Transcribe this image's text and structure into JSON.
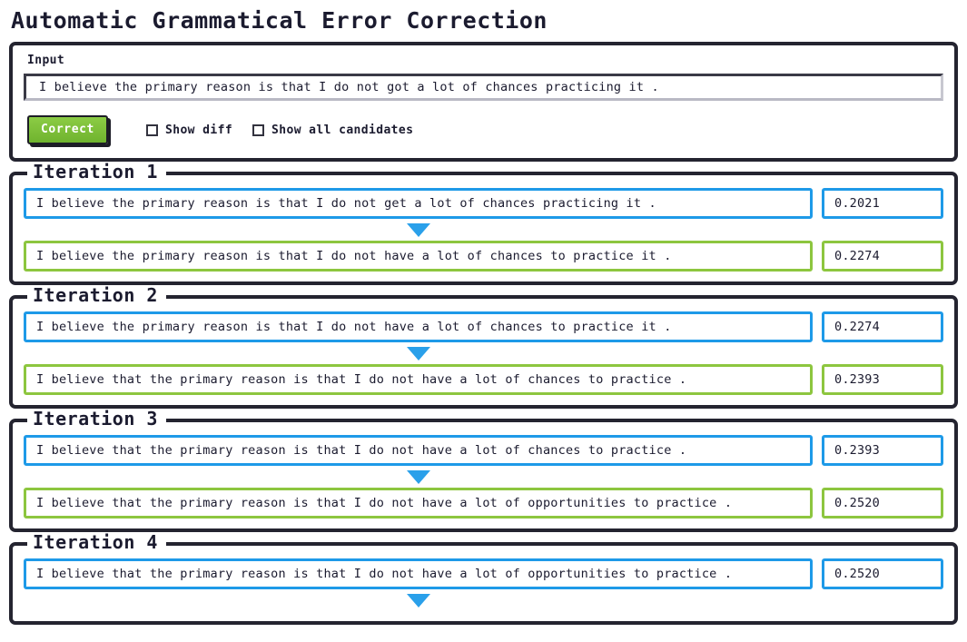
{
  "page": {
    "title": "Automatic Grammatical Error Correction"
  },
  "input_panel": {
    "label": "Input",
    "value": "I believe the primary reason is that I do not got a lot of chances practicing it .",
    "placeholder": "",
    "correct_button": "Correct",
    "checkboxes": [
      {
        "label": "Show diff",
        "checked": false
      },
      {
        "label": "Show all candidates",
        "checked": false
      }
    ]
  },
  "colors": {
    "blue": "#1e9ae8",
    "green": "#8dc63f",
    "arrow": "#2aa0ea",
    "border_dark": "#242430",
    "button_green": "#7cc13a",
    "text": "#1b1b2f"
  },
  "iterations": [
    {
      "legend": "Iteration 1",
      "rows": [
        {
          "color": "blue",
          "sentence": "I believe the primary reason is that I do not get a lot of chances practicing it .",
          "score": "0.2021"
        },
        {
          "color": "green",
          "sentence": "I believe the primary reason is that I do not have a lot of chances to practice it .",
          "score": "0.2274"
        }
      ],
      "arrow_after_first": true,
      "arrow_at_end": false
    },
    {
      "legend": "Iteration 2",
      "rows": [
        {
          "color": "blue",
          "sentence": "I believe the primary reason is that I do not have a lot of chances to practice it .",
          "score": "0.2274"
        },
        {
          "color": "green",
          "sentence": "I believe that the primary reason is that I do not have a lot of chances to practice .",
          "score": "0.2393"
        }
      ],
      "arrow_after_first": true,
      "arrow_at_end": false
    },
    {
      "legend": "Iteration 3",
      "rows": [
        {
          "color": "blue",
          "sentence": "I believe that the primary reason is that I do not have a lot of chances to practice .",
          "score": "0.2393"
        },
        {
          "color": "green",
          "sentence": "I believe that the primary reason is that I do not have a lot of opportunities to practice .",
          "score": "0.2520"
        }
      ],
      "arrow_after_first": true,
      "arrow_at_end": false
    },
    {
      "legend": "Iteration 4",
      "rows": [
        {
          "color": "blue",
          "sentence": "I believe that the primary reason is that I do not have a lot of opportunities to practice .",
          "score": "0.2520"
        }
      ],
      "arrow_after_first": false,
      "arrow_at_end": true
    }
  ]
}
